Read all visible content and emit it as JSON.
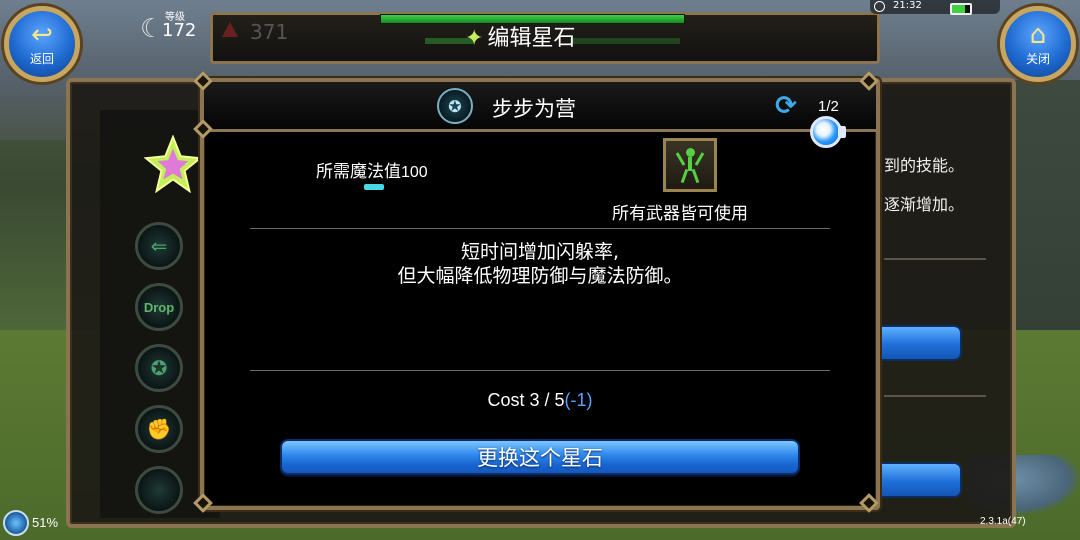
{
  "status": {
    "time": "21:32",
    "network_percent": "51%",
    "version": "2.3.1a(47)"
  },
  "player": {
    "level_label": "等级",
    "level": "172",
    "resource_count": "371"
  },
  "top_bar": {
    "title": "编辑星石",
    "back_label": "返回",
    "close_label": "关闭"
  },
  "background_panel": {
    "text_line_1": "到的技能。",
    "text_line_2": "逐渐增加。",
    "drop_label": "Drop"
  },
  "dialog": {
    "title": "步步为营",
    "page_indicator": "1/2",
    "mana_requirement_label": "所需魔法值",
    "mana_requirement_value": "100",
    "weapon_label": "所有武器皆可使用",
    "description_line_1": "短时间增加闪躲率,",
    "description_line_2": "但大幅降低物理防御与魔法防御。",
    "cost_text": "Cost 3 / 5",
    "cost_delta": "(-1)",
    "change_button_label": "更换这个星石"
  },
  "colors": {
    "frame_gold": "#8a7550",
    "button_blue": "#2d86ec",
    "mana_cyan": "#49d8e8",
    "cost_delta_blue": "#5aa0ff",
    "weapon_icon_green": "#55d040"
  },
  "icons": {
    "back": "back-arrow-icon",
    "close": "home-icon",
    "skill": "skill-emblem-icon",
    "refresh": "refresh-icon",
    "weapon": "stick-figure-icon",
    "star": "star-gem-icon"
  }
}
